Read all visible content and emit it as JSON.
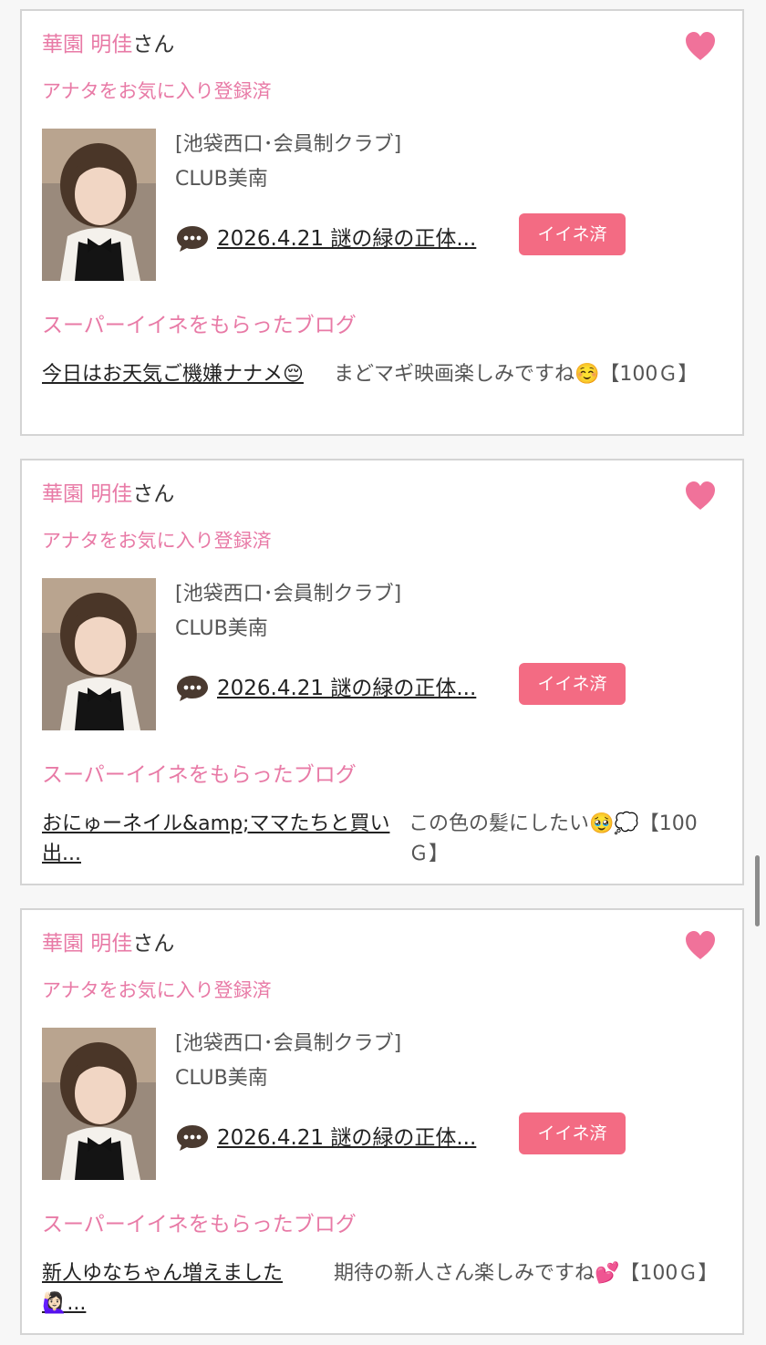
{
  "cards": [
    {
      "name": "華園 明佳",
      "name_suffix": "さん",
      "favorite_status": "アナタをお気に入り登録済",
      "area": "[池袋西口･会員制クラブ]",
      "shop": "CLUB美南",
      "blog_link": "2026.4.21 謎の緑の正体...",
      "like_badge": "イイネ済",
      "super_heading": "スーパーイイネをもらったブログ",
      "blog_title": "今日はお天気ご機嫌ナナメ😔",
      "blog_comment": "まどマギ映画楽しみですね☺️【100Ｇ】"
    },
    {
      "name": "華園 明佳",
      "name_suffix": "さん",
      "favorite_status": "アナタをお気に入り登録済",
      "area": "[池袋西口･会員制クラブ]",
      "shop": "CLUB美南",
      "blog_link": "2026.4.21 謎の緑の正体...",
      "like_badge": "イイネ済",
      "super_heading": "スーパーイイネをもらったブログ",
      "blog_title": "おにゅーネイル&amp;ママたちと買い出...",
      "blog_comment": "この色の髪にしたい🥹💭【100Ｇ】"
    },
    {
      "name": "華園 明佳",
      "name_suffix": "さん",
      "favorite_status": "アナタをお気に入り登録済",
      "area": "[池袋西口･会員制クラブ]",
      "shop": "CLUB美南",
      "blog_link": "2026.4.21 謎の緑の正体...",
      "like_badge": "イイネ済",
      "super_heading": "スーパーイイネをもらったブログ",
      "blog_title": "新人ゆなちゃん増えました🙋🏻‍♀️...",
      "blog_comment": "期待の新人さん楽しみですね💕【100Ｇ】"
    }
  ],
  "colors": {
    "accent_pink": "#e87aa6",
    "badge_red": "#f36b83",
    "heart_pink": "#f0729a",
    "card_border": "#d4d4d4"
  },
  "icons": {
    "favorite": "heart-icon",
    "blog": "speech-bubble-icon"
  }
}
